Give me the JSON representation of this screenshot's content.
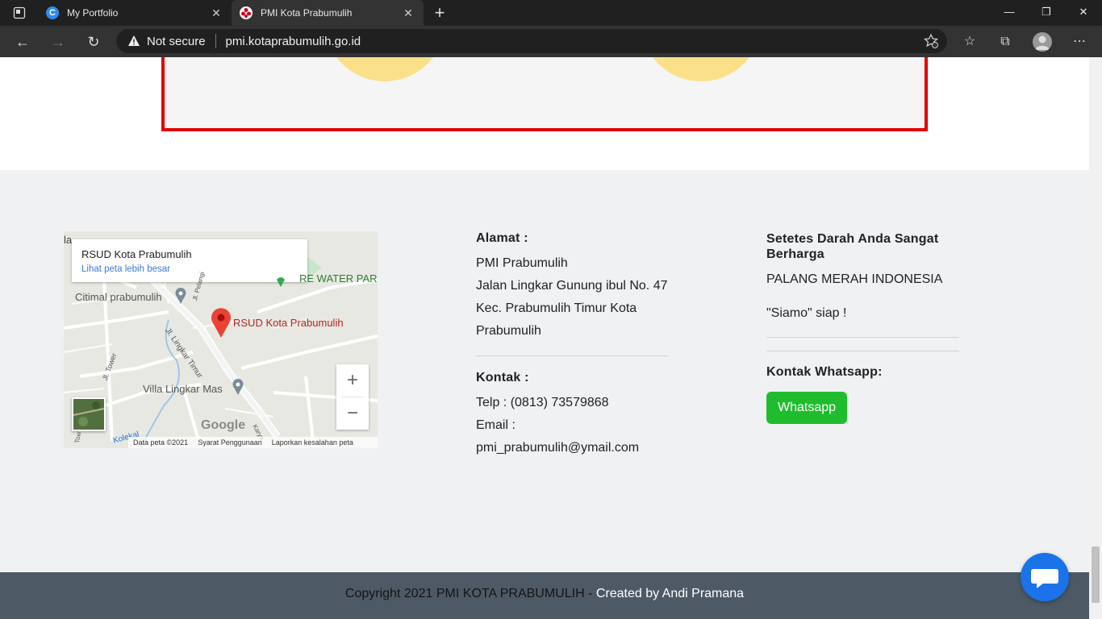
{
  "browser": {
    "tabs": [
      {
        "title": "My Portfolio",
        "active": false
      },
      {
        "title": "PMI Kota Prabumulih",
        "active": true
      }
    ],
    "security_label": "Not secure",
    "url": "pmi.kotaprabumulih.go.id"
  },
  "map": {
    "place_title": "RSUD Kota Prabumulih",
    "larger_map_link": "Lihat peta lebih besar",
    "marker_label": "RSUD Kota Prabumulih",
    "labels": {
      "water_park": "RE WATER PAR",
      "citimal": "Citimal prabumulih",
      "villa": "Villa Lingkar Mas",
      "road_lingkar": "Jl. Lingkar Timur",
      "road_pelangi": "Jl. Pelangi",
      "road_tower": "Jl. Tower",
      "road_karya": "Karya",
      "road_kolekal": "Kolekal",
      "road_tow": "Tow",
      "partial_top": "la"
    },
    "google_logo": "Google",
    "footer": {
      "data": "Data peta ©2021",
      "terms": "Syarat Penggunaan",
      "report": "Laporkan kesalahan peta"
    },
    "zoom_in": "+",
    "zoom_out": "−"
  },
  "address": {
    "heading": "Alamat :",
    "lines": [
      "PMI Prabumulih",
      "Jalan Lingkar Gunung ibul No. 47",
      "Kec. Prabumulih Timur Kota",
      "Prabumulih"
    ]
  },
  "contact": {
    "heading": "Kontak :",
    "phone": "Telp : (0813) 73579868",
    "email_label": "Email :",
    "email": "pmi_prabumulih@ymail.com"
  },
  "slogan": {
    "heading": "Setetes Darah Anda Sangat Berharga",
    "org": "PALANG MERAH INDONESIA",
    "tagline": "\"Siamo\" siap !"
  },
  "whatsapp": {
    "heading": "Kontak Whatsapp:",
    "button": "Whatsapp"
  },
  "footer": {
    "copyright": "Copyright 2021 PMI KOTA PRABUMULIH - ",
    "credit": "Created by Andi Pramana"
  },
  "colors": {
    "accent_red": "#e10000",
    "whatsapp_green": "#1fbd2e",
    "footer_bar": "#4d5a66",
    "chat_blue": "#1a73e8"
  }
}
